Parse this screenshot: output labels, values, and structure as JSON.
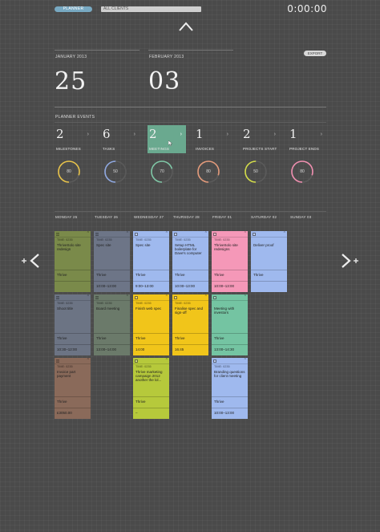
{
  "topbar": {
    "planner_label": "PLANNER",
    "client_filter": "ALL CLIENTS",
    "timer": "0:00:00",
    "export_label": "EXPORT"
  },
  "date_range": {
    "start_month": "JANUARY 2013",
    "start_day": "25",
    "end_month": "FEBRUARY 2013",
    "end_day": "03"
  },
  "events_section_title": "PLANNER EVENTS",
  "stats": [
    {
      "count": "2",
      "label": "MILESTONES",
      "percent": 80,
      "ring_color": "#e8c34a",
      "active": false
    },
    {
      "count": "6",
      "label": "TASKS",
      "percent": 50,
      "ring_color": "#8fa8e0",
      "active": false
    },
    {
      "count": "2",
      "label": "MEETINGS",
      "percent": 70,
      "ring_color": "#7fc7a6",
      "active": true
    },
    {
      "count": "1",
      "label": "INVOICES",
      "percent": 80,
      "ring_color": "#e39a7a",
      "active": false
    },
    {
      "count": "2",
      "label": "PROJECTS START",
      "percent": 50,
      "ring_color": "#d3dc4a",
      "active": false
    },
    {
      "count": "1",
      "label": "PROJECT ENDS",
      "percent": 80,
      "ring_color": "#f08fb0",
      "active": false
    }
  ],
  "days": [
    "MONDAY 25",
    "TUESDAY 26",
    "WEDNESDAY 27",
    "THURSDAY 28",
    "FRIDAY 01",
    "SATURDAY 02",
    "SUNDAY 03"
  ],
  "colors": {
    "olive": "#7a8a4a",
    "slate": "#6d7587",
    "blue": "#9fb9ee",
    "pink": "#f598b8",
    "grayblue": "#6c7484",
    "sage": "#6b7a6a",
    "yellow": "#f1c51a",
    "green": "#74c4a2",
    "brown": "#8a6a5a",
    "lime": "#b6c93b"
  },
  "cards": [
    {
      "col": 0,
      "row": 0,
      "color": "olive",
      "icon": "list",
      "time": "TIME: 0235",
      "title": "ThriveSolo site redesign",
      "client": "Thrive",
      "hours": ""
    },
    {
      "col": 1,
      "row": 0,
      "color": "slate",
      "icon": "list",
      "time": "TIME: 0235",
      "title": "Spec site",
      "client": "Thrive",
      "hours": "10:00–13:00"
    },
    {
      "col": 2,
      "row": 0,
      "color": "blue",
      "icon": "check",
      "time": "TIME: 0235",
      "title": "Spec site",
      "client": "Thrive",
      "hours": "9:00–13:00"
    },
    {
      "col": 3,
      "row": 0,
      "color": "blue",
      "icon": "check",
      "time": "TIME: 0235",
      "title": "Setup HTML boilerplate for Dave's computer",
      "client": "Thrive",
      "hours": "10:00–13:00"
    },
    {
      "col": 4,
      "row": 0,
      "color": "pink",
      "icon": "check",
      "time": "TIME: 0235",
      "title": "ThriveSolo site redesigns",
      "client": "Thrive",
      "hours": "10:00–13:00"
    },
    {
      "col": 5,
      "row": 0,
      "color": "blue",
      "icon": "check",
      "time": "",
      "title": "Deliver proof",
      "client": "Thrive",
      "hours": ""
    },
    {
      "col": 0,
      "row": 1,
      "color": "grayblue",
      "icon": "list",
      "time": "TIME: 0235",
      "title": "Shoot title",
      "client": "Thrive",
      "hours": "10:30–12:00"
    },
    {
      "col": 1,
      "row": 1,
      "color": "sage",
      "icon": "list",
      "time": "TIME: 0235",
      "title": "Board meeting",
      "client": "Thrive",
      "hours": "13:00–14:00"
    },
    {
      "col": 2,
      "row": 1,
      "color": "yellow",
      "icon": "check",
      "time": "TIME: 0235",
      "title": "Finish web spec",
      "client": "Thrive",
      "hours": "14:00"
    },
    {
      "col": 3,
      "row": 1,
      "color": "yellow",
      "icon": "check",
      "time": "TIME: 0235",
      "title": "Finalise spec and sign-off",
      "client": "Thrive",
      "hours": "16:45"
    },
    {
      "col": 4,
      "row": 1,
      "color": "green",
      "icon": "check",
      "time": "",
      "title": "Meeting with investors",
      "client": "Thrive",
      "hours": "13:00–14:30"
    },
    {
      "col": 0,
      "row": 2,
      "color": "brown",
      "icon": "list",
      "time": "TIME: 0235",
      "title": "Invoice part payment",
      "client": "Thrive",
      "hours": "£3050.00"
    },
    {
      "col": 2,
      "row": 2,
      "color": "lime",
      "icon": "check",
      "time": "TIME: 0235",
      "title": "Thrive marketing campaign 2012 another the lol...",
      "client": "Thrive",
      "hours": "–"
    },
    {
      "col": 4,
      "row": 2,
      "color": "blue",
      "icon": "check",
      "time": "TIME: 0235",
      "title": "Branding questions for client meeting",
      "client": "Thrive",
      "hours": "10:00–13:00"
    }
  ]
}
